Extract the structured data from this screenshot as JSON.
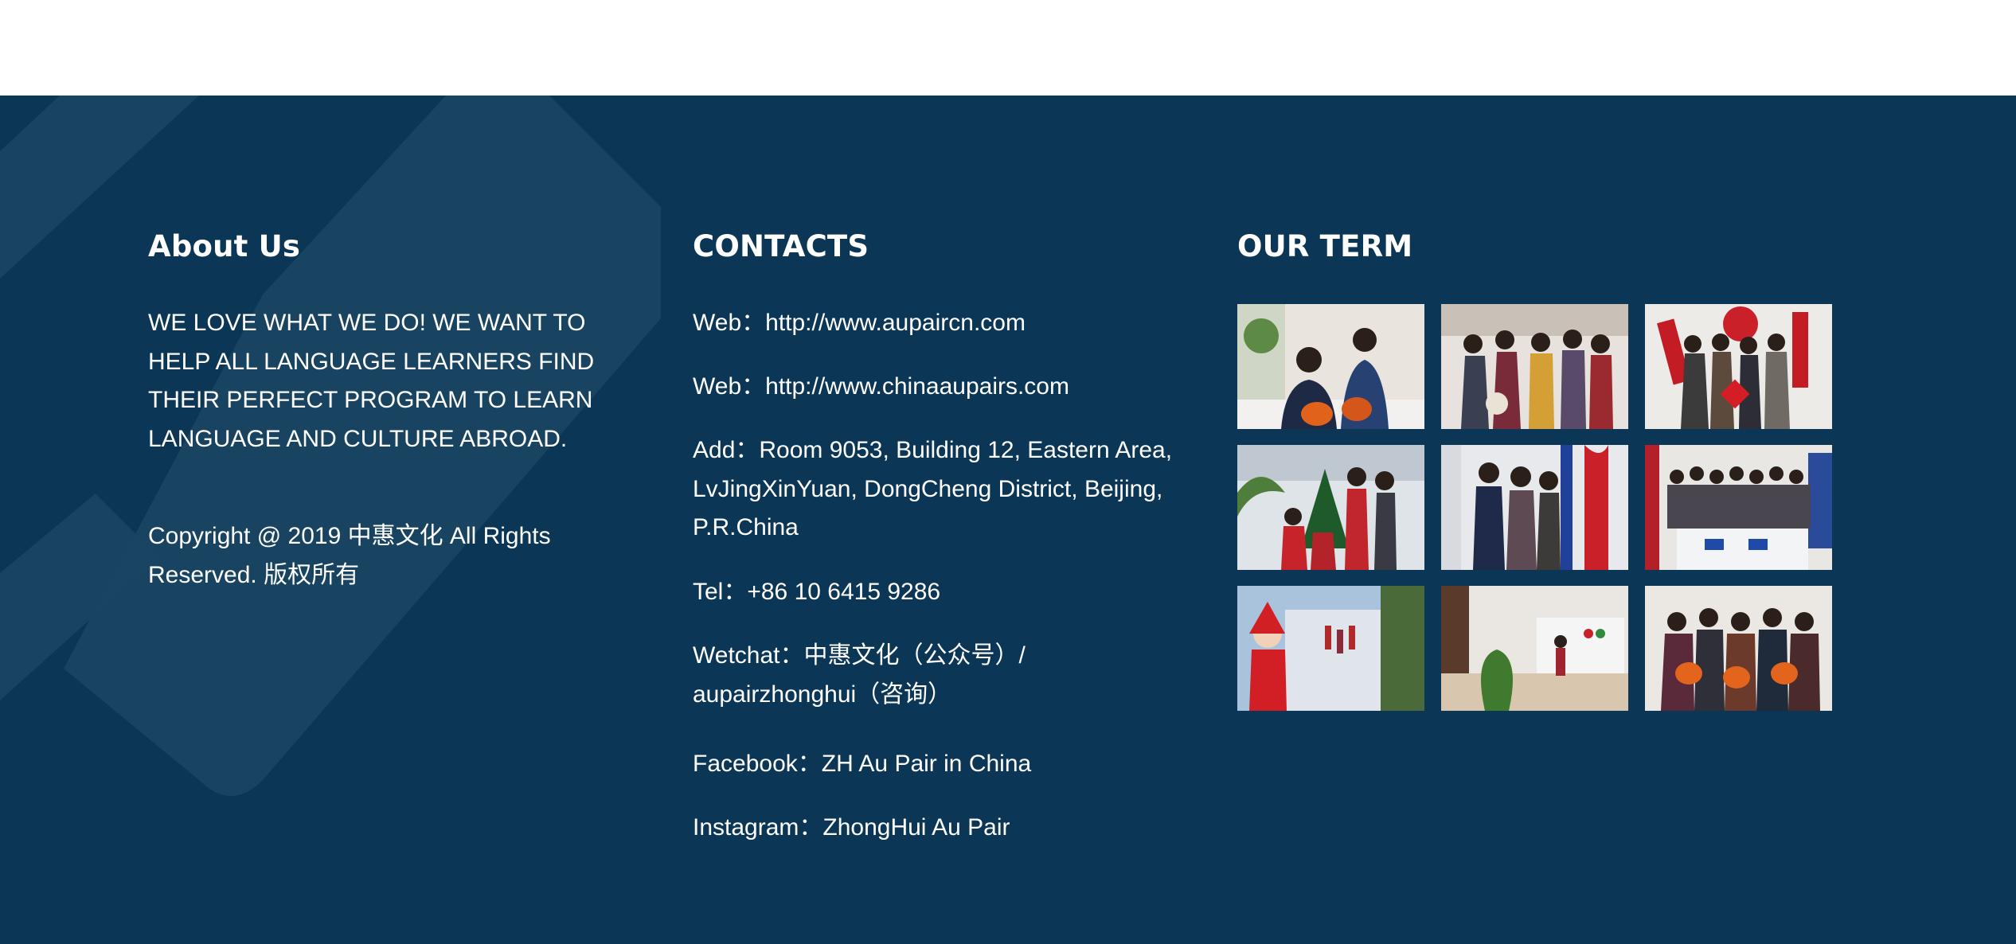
{
  "about": {
    "heading": "About Us",
    "text": "WE LOVE WHAT WE DO! WE WANT TO HELP ALL LANGUAGE LEARNERS FIND THEIR PERFECT PROGRAM TO LEARN LANGUAGE AND CULTURE ABROAD.",
    "copyright_line1": "Copyright @ 2019 中惠文化 All Rights",
    "copyright_line2": "Reserved. 版权所有"
  },
  "contacts": {
    "heading": "CONTACTS",
    "web1": "Web：http://www.aupaircn.com",
    "web2": "Web：http://www.chinaaupairs.com",
    "address_line1": "Add：Room 9053, Building 12, Eastern Area,",
    "address_line2": "LvJingXinYuan, DongCheng District, Beijing,",
    "address_line3": "P.R.China",
    "tel": "Tel：+86 10 6415 9286",
    "wechat_line1": "Wetchat：中惠文化（公众号）/",
    "wechat_line2": "aupairzhonghui（咨询）",
    "facebook": "Facebook：ZH Au Pair in China",
    "instagram": "Instagram：ZhongHui Au Pair"
  },
  "term": {
    "heading": "OUR TERM"
  },
  "colors": {
    "footer_background": "#0b3656",
    "text": "#ffffff"
  }
}
